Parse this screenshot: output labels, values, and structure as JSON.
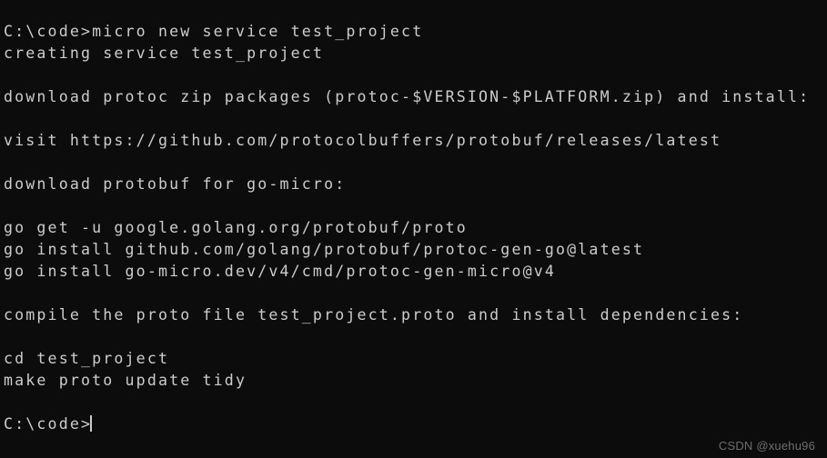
{
  "terminal": {
    "background_color": "#0C0C0C",
    "foreground_color": "#CCCCCC",
    "cursor": {
      "shape": "vertical-bar",
      "color": "#CCCCCC"
    },
    "lines": [
      {
        "id": "line-1",
        "text": "C:\\code>micro new service test_project"
      },
      {
        "id": "line-2",
        "text": "creating service test_project"
      },
      {
        "id": "line-3",
        "text": ""
      },
      {
        "id": "line-4",
        "text": "download protoc zip packages (protoc-$VERSION-$PLATFORM.zip) and install:"
      },
      {
        "id": "line-5",
        "text": ""
      },
      {
        "id": "line-6",
        "text": "visit https://github.com/protocolbuffers/protobuf/releases/latest"
      },
      {
        "id": "line-7",
        "text": ""
      },
      {
        "id": "line-8",
        "text": "download protobuf for go-micro:"
      },
      {
        "id": "line-9",
        "text": ""
      },
      {
        "id": "line-10",
        "text": "go get -u google.golang.org/protobuf/proto"
      },
      {
        "id": "line-11",
        "text": "go install github.com/golang/protobuf/protoc-gen-go@latest"
      },
      {
        "id": "line-12",
        "text": "go install go-micro.dev/v4/cmd/protoc-gen-micro@v4"
      },
      {
        "id": "line-13",
        "text": ""
      },
      {
        "id": "line-14",
        "text": "compile the proto file test_project.proto and install dependencies:"
      },
      {
        "id": "line-15",
        "text": ""
      },
      {
        "id": "line-16",
        "text": "cd test_project"
      },
      {
        "id": "line-17",
        "text": "make proto update tidy"
      },
      {
        "id": "line-18",
        "text": ""
      }
    ],
    "prompt": {
      "text": "C:\\code>"
    }
  },
  "watermark": {
    "text": "CSDN @xuehu96",
    "color": "#6E6E6E"
  }
}
